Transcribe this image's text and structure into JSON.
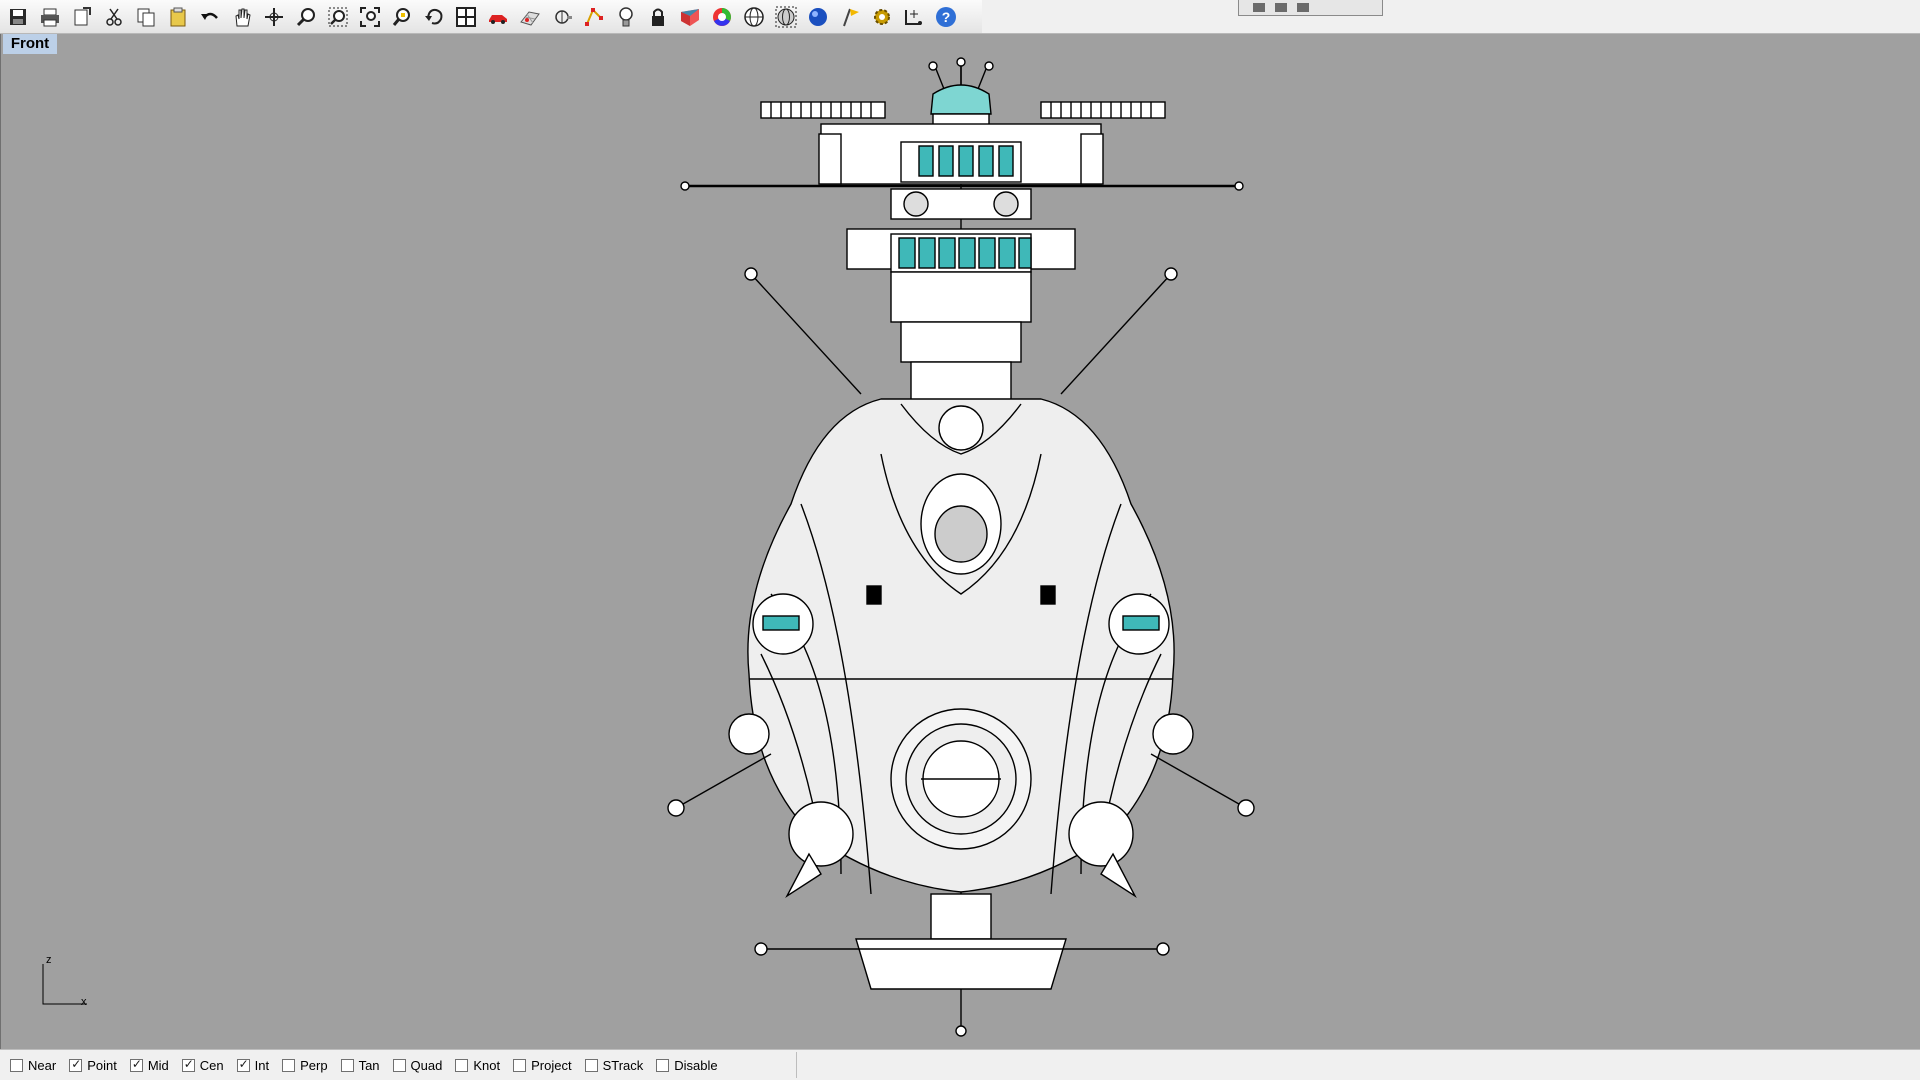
{
  "toolbar": {
    "buttons": [
      {
        "name": "save-icon"
      },
      {
        "name": "print-icon"
      },
      {
        "name": "export-icon"
      },
      {
        "name": "cut-icon"
      },
      {
        "name": "copy-icon"
      },
      {
        "name": "paste-icon"
      },
      {
        "name": "undo-icon"
      },
      {
        "name": "pan-hand-icon"
      },
      {
        "name": "rotate-view-icon"
      },
      {
        "name": "zoom-icon"
      },
      {
        "name": "zoom-window-icon"
      },
      {
        "name": "zoom-extents-icon"
      },
      {
        "name": "zoom-selected-icon"
      },
      {
        "name": "undo-view-icon"
      },
      {
        "name": "four-viewports-icon"
      },
      {
        "name": "car-icon"
      },
      {
        "name": "grid-plane-icon"
      },
      {
        "name": "osnap-icon"
      },
      {
        "name": "select-points-icon"
      },
      {
        "name": "light-bulb-icon"
      },
      {
        "name": "lock-icon"
      },
      {
        "name": "layers-icon"
      },
      {
        "name": "color-wheel-icon"
      },
      {
        "name": "wireframe-sphere-icon"
      },
      {
        "name": "ghosted-sphere-icon"
      },
      {
        "name": "rendered-sphere-icon"
      },
      {
        "name": "render-flag-icon"
      },
      {
        "name": "options-gear-icon"
      },
      {
        "name": "dimension-icon"
      },
      {
        "name": "help-icon"
      }
    ]
  },
  "viewport": {
    "title": "Front"
  },
  "axes": {
    "z": "z",
    "x": "x"
  },
  "osnap": [
    {
      "label": "Near",
      "checked": false
    },
    {
      "label": "Point",
      "checked": true
    },
    {
      "label": "Mid",
      "checked": true
    },
    {
      "label": "Cen",
      "checked": true
    },
    {
      "label": "Int",
      "checked": true
    },
    {
      "label": "Perp",
      "checked": false
    },
    {
      "label": "Tan",
      "checked": false
    },
    {
      "label": "Quad",
      "checked": false
    },
    {
      "label": "Knot",
      "checked": false
    },
    {
      "label": "Project",
      "checked": false
    },
    {
      "label": "STrack",
      "checked": false
    },
    {
      "label": "Disable",
      "checked": false
    }
  ],
  "colors": {
    "viewport_bg": "#a0a0a0",
    "accent_teal": "#3fb8b8",
    "title_bg": "#bcd0e8"
  }
}
